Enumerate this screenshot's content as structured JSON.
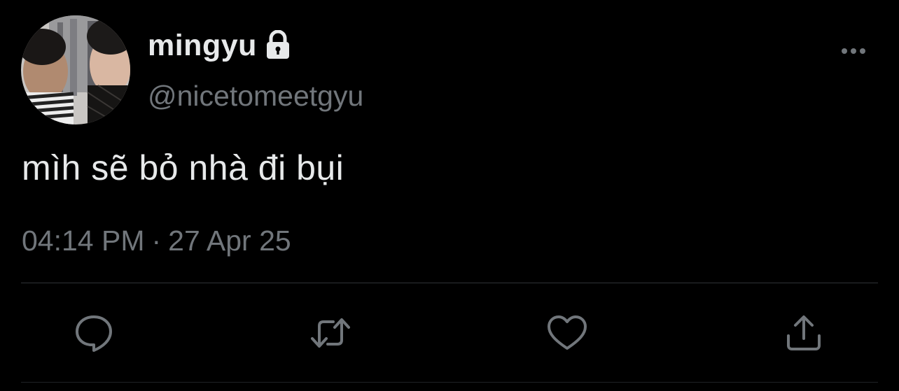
{
  "user": {
    "display_name": "mingyu",
    "handle": "@nicetomeetgyu",
    "avatar_icon": "profile-photo",
    "protected_icon": "lock-icon"
  },
  "tweet": {
    "text": "mìh sẽ bỏ nhà đi bụi",
    "time": "04:14 PM",
    "separator": "·",
    "date": "27 Apr 25"
  },
  "actions": [
    {
      "icon": "reply-icon"
    },
    {
      "icon": "retweet-icon"
    },
    {
      "icon": "like-icon"
    },
    {
      "icon": "share-icon"
    }
  ],
  "colors": {
    "background": "#000000",
    "primary_text": "#e7e9ea",
    "secondary_text": "#71767b",
    "divider": "#2f3336",
    "icon": "#71767b"
  }
}
